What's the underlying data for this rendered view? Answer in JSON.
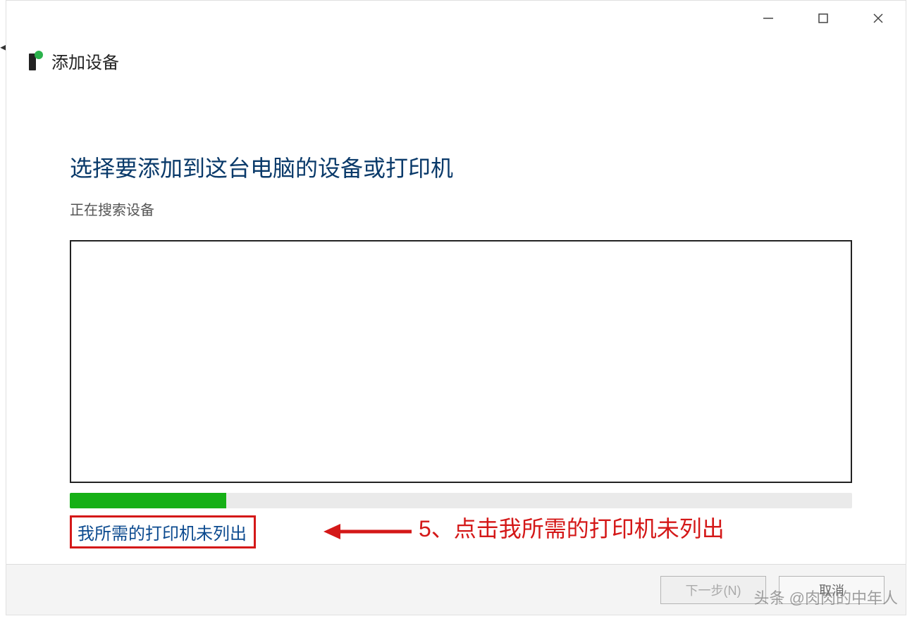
{
  "window": {
    "title": "添加设备"
  },
  "content": {
    "heading": "选择要添加到这台电脑的设备或打印机",
    "subheading": "正在搜索设备",
    "progress_percent": 20,
    "link_text": "我所需的打印机未列出"
  },
  "annotation": {
    "text": "5、点击我所需的打印机未列出",
    "color": "#d41818"
  },
  "footer": {
    "next_label": "下一步(N)",
    "cancel_label": "取消"
  },
  "watermark": "头条 @肉肉的中年人"
}
